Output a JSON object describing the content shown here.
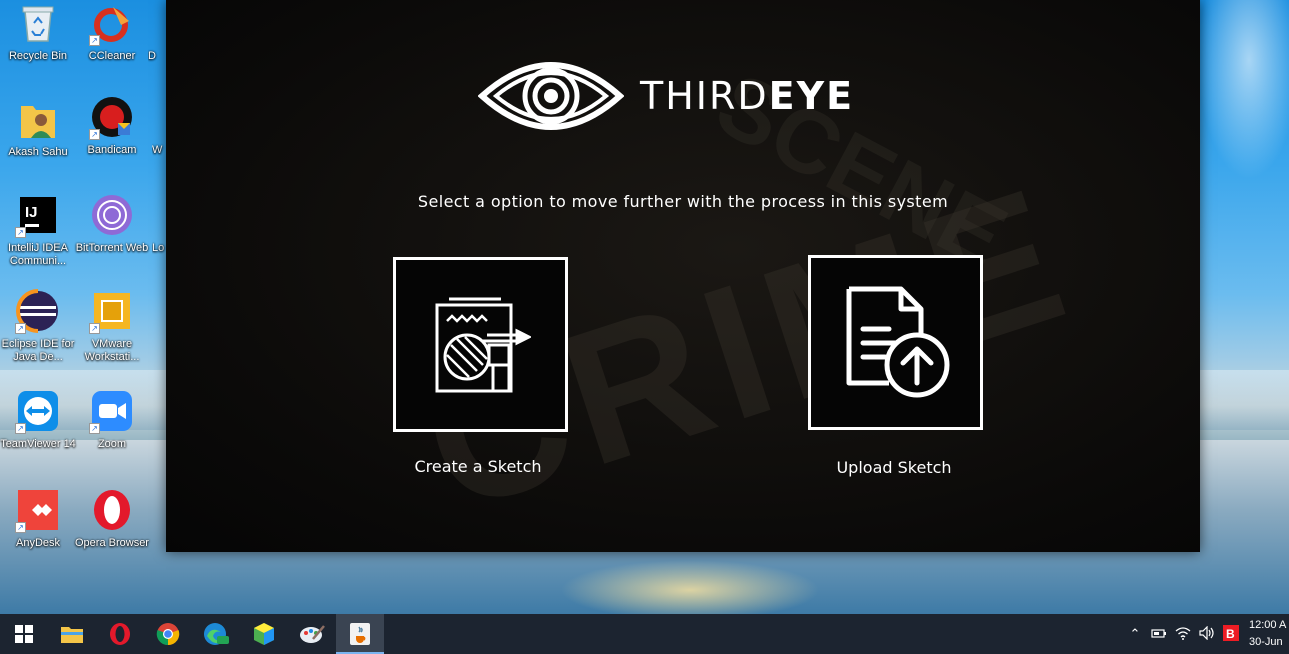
{
  "desktop": {
    "icons": [
      {
        "label": "Recycle Bin",
        "icon": "recycle-bin-icon"
      },
      {
        "label": "CCleaner",
        "icon": "ccleaner-icon"
      },
      {
        "label": "D",
        "icon": "folder-icon"
      },
      {
        "label": "Akash Sahu",
        "icon": "user-folder-icon"
      },
      {
        "label": "Bandicam",
        "icon": "bandicam-icon"
      },
      {
        "label": "W",
        "icon": "app-icon"
      },
      {
        "label": "IntelliJ IDEA Communi...",
        "icon": "intellij-icon"
      },
      {
        "label": "BitTorrent Web",
        "icon": "bittorrent-icon"
      },
      {
        "label": "Lo",
        "icon": "app-icon"
      },
      {
        "label": "Eclipse IDE for Java De...",
        "icon": "eclipse-icon"
      },
      {
        "label": "VMware Workstati...",
        "icon": "vmware-icon"
      },
      {
        "label": "TeamViewer 14",
        "icon": "teamviewer-icon"
      },
      {
        "label": "Zoom",
        "icon": "zoom-icon"
      },
      {
        "label": "AnyDesk",
        "icon": "anydesk-icon"
      },
      {
        "label": "Opera Browser",
        "icon": "opera-icon"
      }
    ]
  },
  "app": {
    "brand_light": "THIRD",
    "brand_bold": "EYE",
    "prompt": "Select a option to move further with the process in this system",
    "options": [
      {
        "label": "Create a Sketch",
        "icon": "sketch-drawing-icon"
      },
      {
        "label": "Upload Sketch",
        "icon": "document-upload-icon"
      }
    ]
  },
  "taskbar": {
    "items": [
      "start-icon",
      "file-explorer-icon",
      "opera-icon",
      "chrome-icon",
      "edge-icon",
      "app-cube-icon",
      "paint-icon",
      "java-app-icon"
    ],
    "active_index": 7,
    "clock_time": "12:00 A",
    "clock_date": "30-Jun"
  },
  "colors": {
    "window_bg": "#0b0a09",
    "taskbar_bg": "#1c2430",
    "accent": "#ffffff"
  }
}
